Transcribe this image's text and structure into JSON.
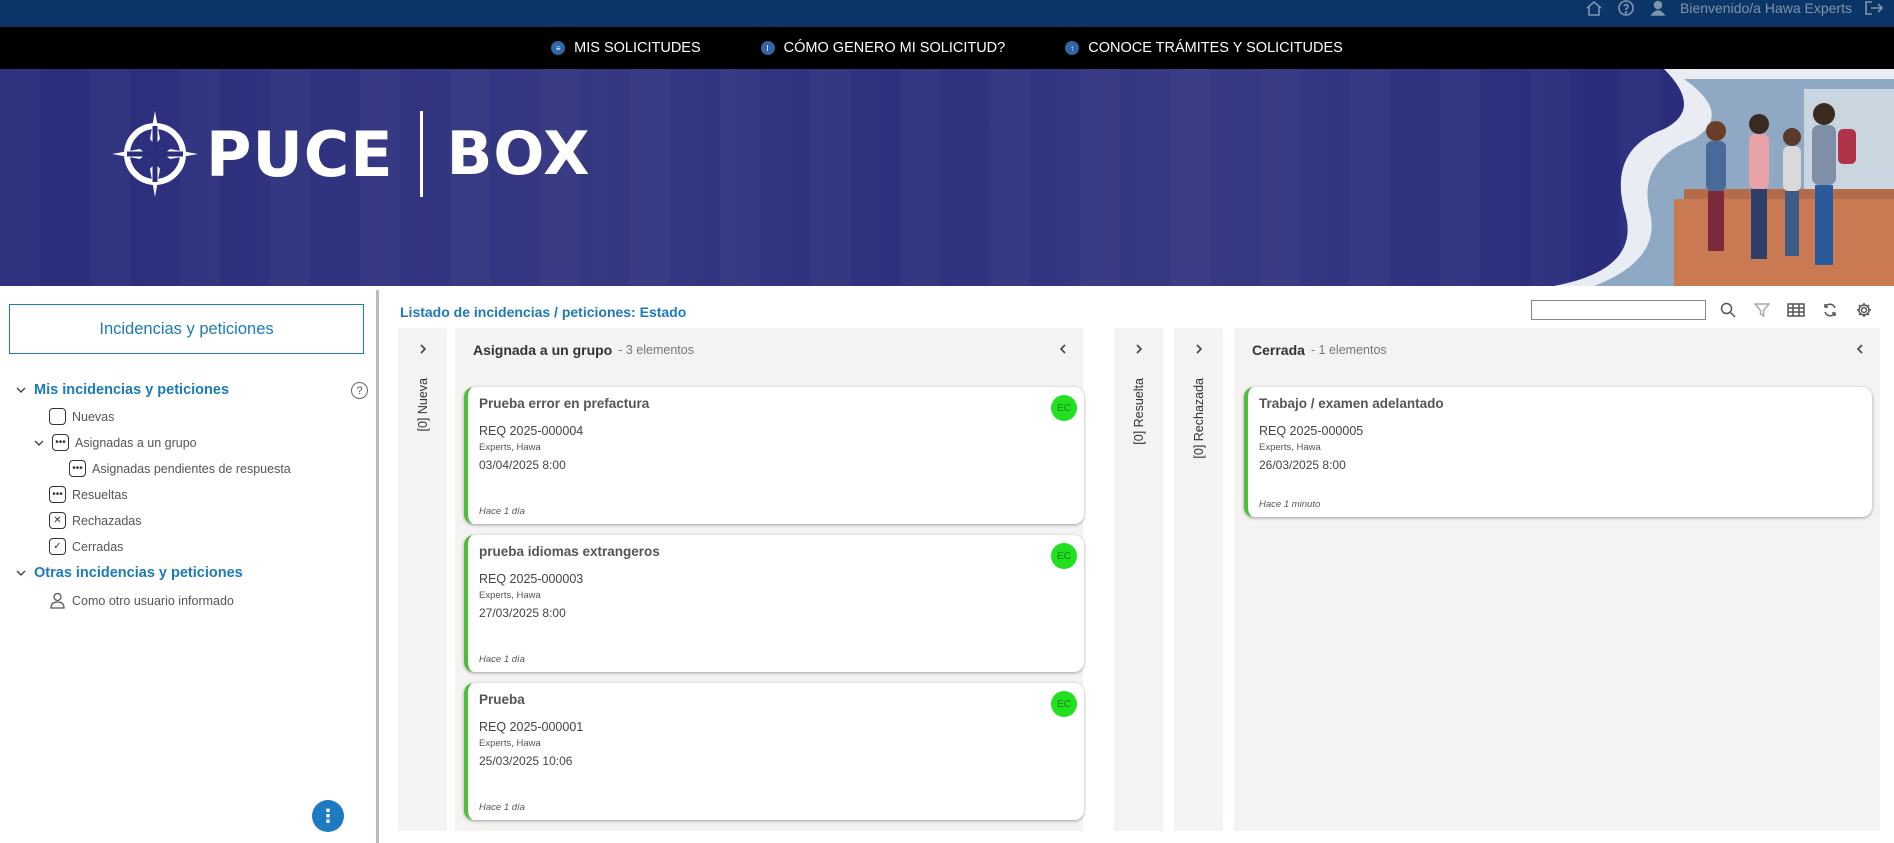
{
  "topbar": {
    "welcome": "Bienvenido/a Hawa Experts",
    "icons": [
      "home-icon",
      "help-icon",
      "user-icon",
      "logout-icon"
    ]
  },
  "nav": {
    "items": [
      {
        "label": "MIS SOLICITUDES",
        "icon": "list-icon"
      },
      {
        "label": "CÓMO GENERO MI SOLICITUD?",
        "icon": "info-icon"
      },
      {
        "label": "CONOCE TRÁMITES Y SOLICITUDES",
        "icon": "upload-icon"
      }
    ]
  },
  "banner": {
    "brand": "PUCE",
    "product": "BOX"
  },
  "sidebar": {
    "title": "Incidencias y peticiones",
    "mine_heading": "Mis incidencias y peticiones",
    "help": "?",
    "items": [
      {
        "label": "Nuevas",
        "mark": ""
      },
      {
        "label": "Asignadas a un grupo",
        "mark": "•••"
      },
      {
        "label": "Asignadas pendientes de respuesta",
        "mark": "•••"
      },
      {
        "label": "Resueltas",
        "mark": "•••"
      },
      {
        "label": "Rechazadas",
        "mark": "✕"
      },
      {
        "label": "Cerradas",
        "mark": "✓"
      }
    ],
    "others_heading": "Otras incidencias y peticiones",
    "other_item": "Como otro usuario informado",
    "fab": "⋮"
  },
  "main": {
    "title": "Listado de incidencias / peticiones: Estado",
    "search_placeholder": "",
    "columns": {
      "nueva": "[0] Nueva",
      "asignada": {
        "name": "Asignada a un grupo",
        "count": "- 3 elementos"
      },
      "resuelta": "[0] Resuelta",
      "rechazada": "[0] Rechazada",
      "cerrada": {
        "name": "Cerrada",
        "count": "- 1 elementos"
      }
    },
    "cards": [
      {
        "title": "Prueba error en prefactura",
        "req": "REQ 2025-000004",
        "user": "Experts, Hawa",
        "date": "03/04/2025 8:00",
        "ago": "Hace 1 día",
        "badge": "EC"
      },
      {
        "title": "prueba idiomas extrangeros",
        "req": "REQ 2025-000003",
        "user": "Experts, Hawa",
        "date": "27/03/2025 8:00",
        "ago": "Hace 1 día",
        "badge": "EC"
      },
      {
        "title": "Prueba",
        "req": "REQ 2025-000001",
        "user": "Experts, Hawa",
        "date": "25/03/2025 10:06",
        "ago": "Hace 1 día",
        "badge": "EC"
      },
      {
        "title": "Trabajo / examen adelantado",
        "req": "REQ 2025-000005",
        "user": "Experts, Hawa",
        "date": "26/03/2025 8:00",
        "ago": "Hace 1 minuto"
      }
    ]
  },
  "colors": {
    "topbar": "#0b3566",
    "navbar": "#000000",
    "banner": "#2a2d7c",
    "accent": "#1c7ab8",
    "card_border": "#4fbe3d",
    "badge": "#20e020"
  }
}
